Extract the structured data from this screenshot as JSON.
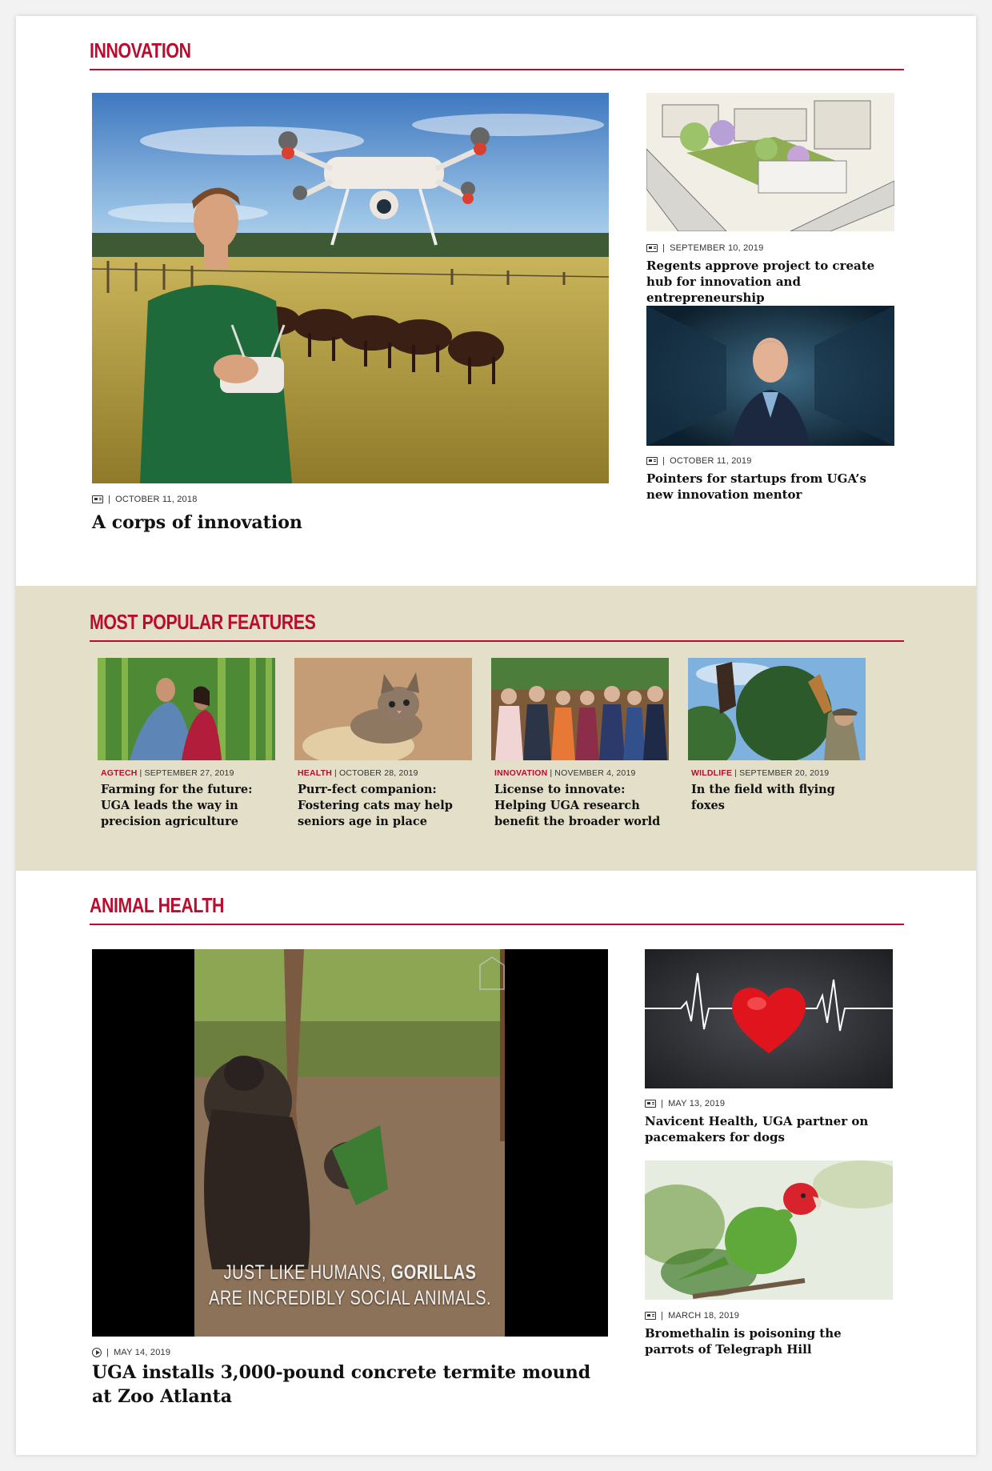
{
  "innovation": {
    "title": "INNOVATION",
    "main": {
      "date": "OCTOBER 11, 2018",
      "headline": "A corps of innovation"
    },
    "side": [
      {
        "date": "SEPTEMBER 10, 2019",
        "headline": "Regents approve project to create hub for innovation and entrepreneurship"
      },
      {
        "date": "OCTOBER 11, 2019",
        "headline": "Pointers for startups from UGA’s new innovation mentor"
      }
    ]
  },
  "popular": {
    "title": "MOST POPULAR FEATURES",
    "items": [
      {
        "category": "AGTECH",
        "date": "SEPTEMBER 27, 2019",
        "headline": "Farming for the future: UGA leads the way in precision agriculture"
      },
      {
        "category": "HEALTH",
        "date": "OCTOBER 28, 2019",
        "headline": "Purr-fect companion: Fostering cats may help seniors age in place"
      },
      {
        "category": "INNOVATION",
        "date": "NOVEMBER 4, 2019",
        "headline": "License to innovate: Helping UGA research benefit the broader world"
      },
      {
        "category": "WILDLIFE",
        "date": "SEPTEMBER 20, 2019",
        "headline": "In the field with flying foxes"
      }
    ]
  },
  "animal": {
    "title": "ANIMAL HEALTH",
    "main": {
      "video_caption_line1_a": "JUST LIKE HUMANS, ",
      "video_caption_line1_b": "GORILLAS",
      "video_caption_line2": "ARE INCREDIBLY SOCIAL ANIMALS.",
      "date": "MAY 14, 2019",
      "headline": "UGA installs 3,000-pound concrete termite mound at Zoo Atlanta"
    },
    "side": [
      {
        "date": "MAY 13, 2019",
        "headline": "Navicent Health, UGA partner on pacemakers for dogs"
      },
      {
        "date": "MARCH 18, 2019",
        "headline": "Bromethalin is poisoning the parrots of Telegraph Hill"
      }
    ]
  },
  "colors": {
    "accent": "#ba0c2f",
    "band": "#e4dfc9"
  },
  "separator": "|"
}
